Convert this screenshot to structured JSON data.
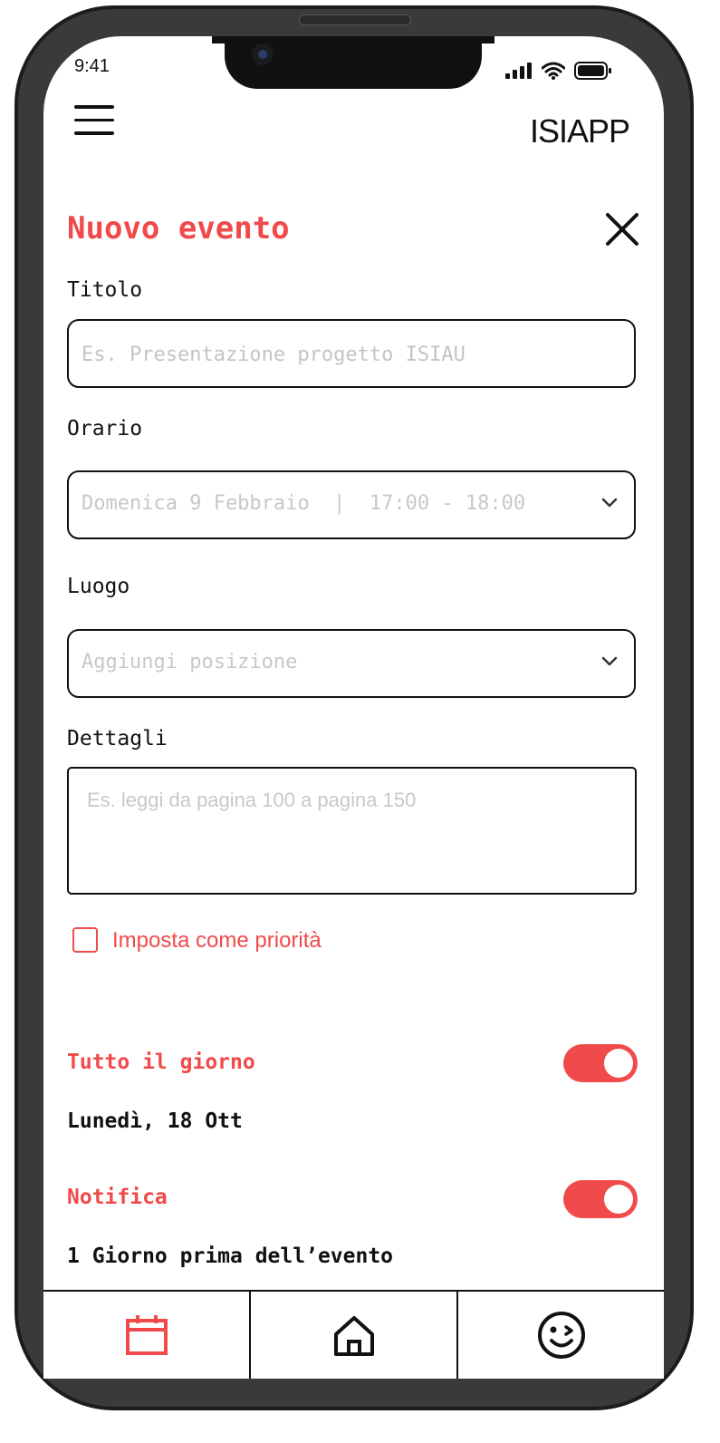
{
  "status_bar": {
    "time": "9:41"
  },
  "header": {
    "brand": "ISIAPP"
  },
  "form": {
    "title": "Nuovo evento",
    "titolo": {
      "label": "Titolo",
      "placeholder": "Es. Presentazione progetto ISIAU"
    },
    "orario": {
      "label": "Orario",
      "value": "Domenica 9 Febbraio  |  17:00 - 18:00"
    },
    "luogo": {
      "label": "Luogo",
      "value": "Aggiungi posizione"
    },
    "dettagli": {
      "label": "Dettagli",
      "placeholder": "Es. leggi da pagina 100 a pagina 150"
    },
    "priority_label": "Imposta come priorità"
  },
  "all_day": {
    "label": "Tutto il giorno",
    "value": "Lunedì, 18 Ott"
  },
  "notification": {
    "label": "Notifica",
    "value": "1 Giorno prima dell’evento"
  },
  "tabs": [
    {
      "icon": "calendar-icon",
      "color": "#f04a4a"
    },
    {
      "icon": "home-icon",
      "color": "#111111"
    },
    {
      "icon": "winking-face-icon",
      "color": "#111111"
    }
  ],
  "colors": {
    "accent": "#f04a4a",
    "text": "#111111",
    "placeholder": "#c4c4c4"
  }
}
